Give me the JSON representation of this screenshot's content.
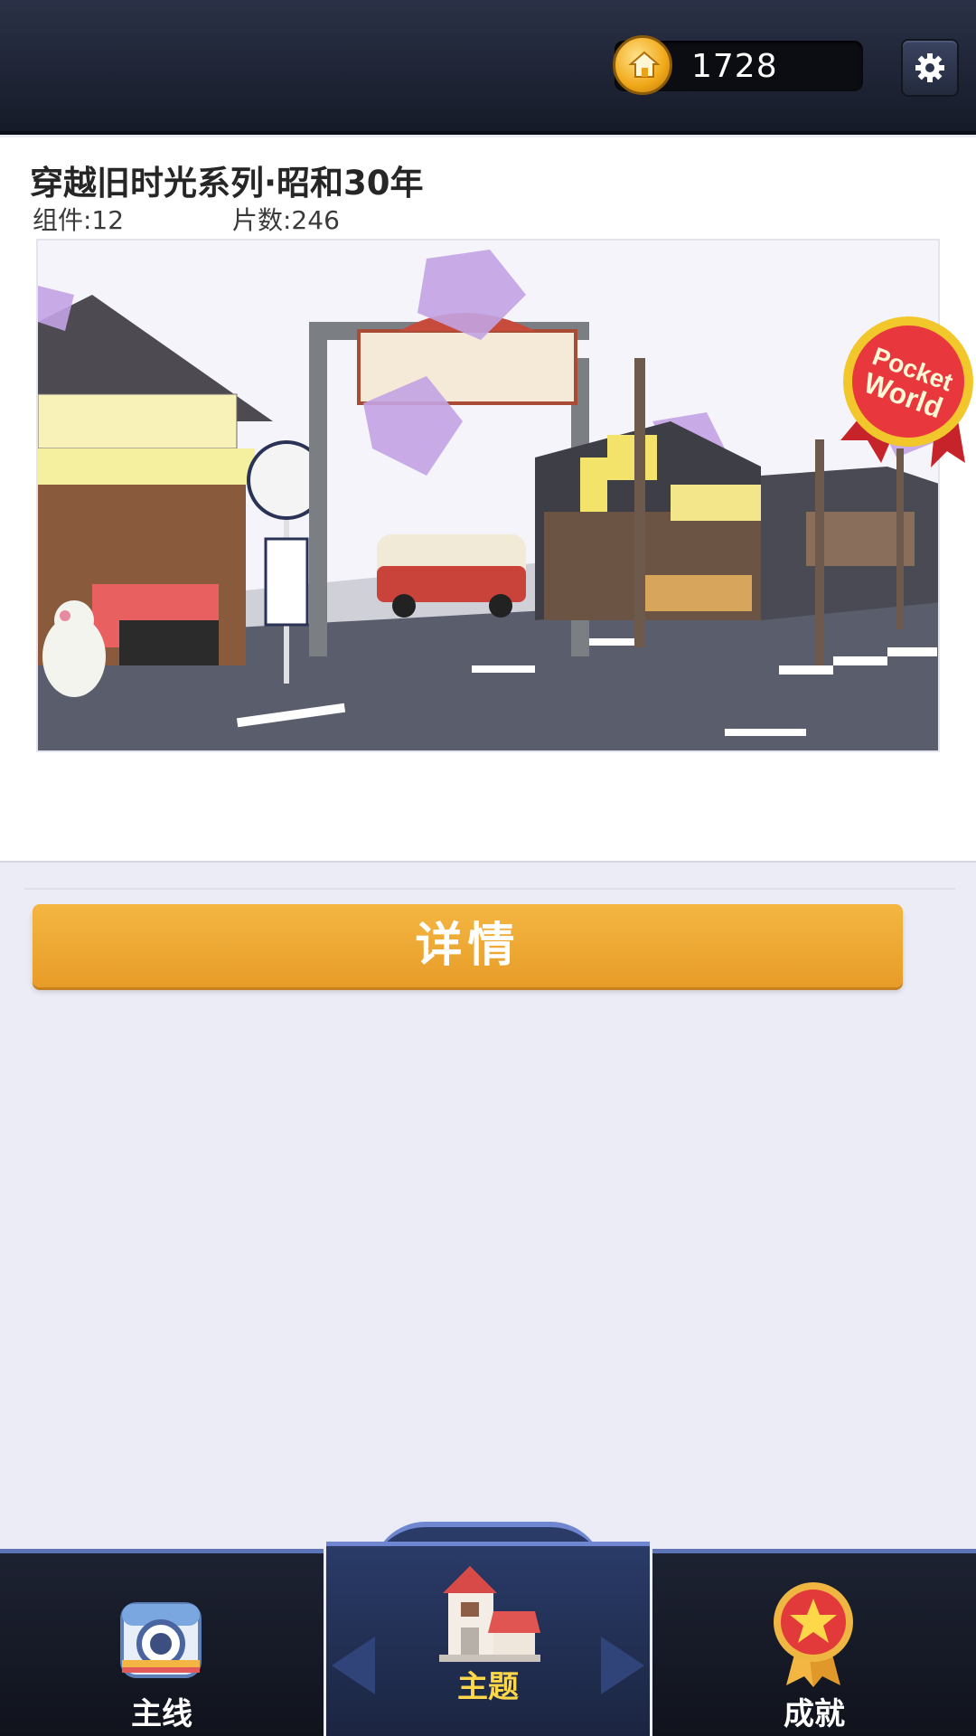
{
  "header": {
    "coin_value": "1728",
    "coin_icon": "coin-house-icon",
    "settings_icon": "gear-icon"
  },
  "theme_card": {
    "title": "穿越旧时光系列·昭和30年",
    "parts_label": "组件:12",
    "pieces_label": "片数:246",
    "badge_line1": "Pocket",
    "badge_line2": "World",
    "details_button": "详情"
  },
  "bottom_nav": {
    "items": [
      {
        "label": "主线",
        "icon": "camera-icon",
        "active": false
      },
      {
        "label": "主题",
        "icon": "house-icon",
        "active": true
      },
      {
        "label": "成就",
        "icon": "star-medal-icon",
        "active": false
      }
    ]
  },
  "colors": {
    "accent": "#f0a832",
    "active_tab_label": "#ffd84a",
    "topbar": "#1c2231",
    "page_bg": "#ececf6"
  }
}
